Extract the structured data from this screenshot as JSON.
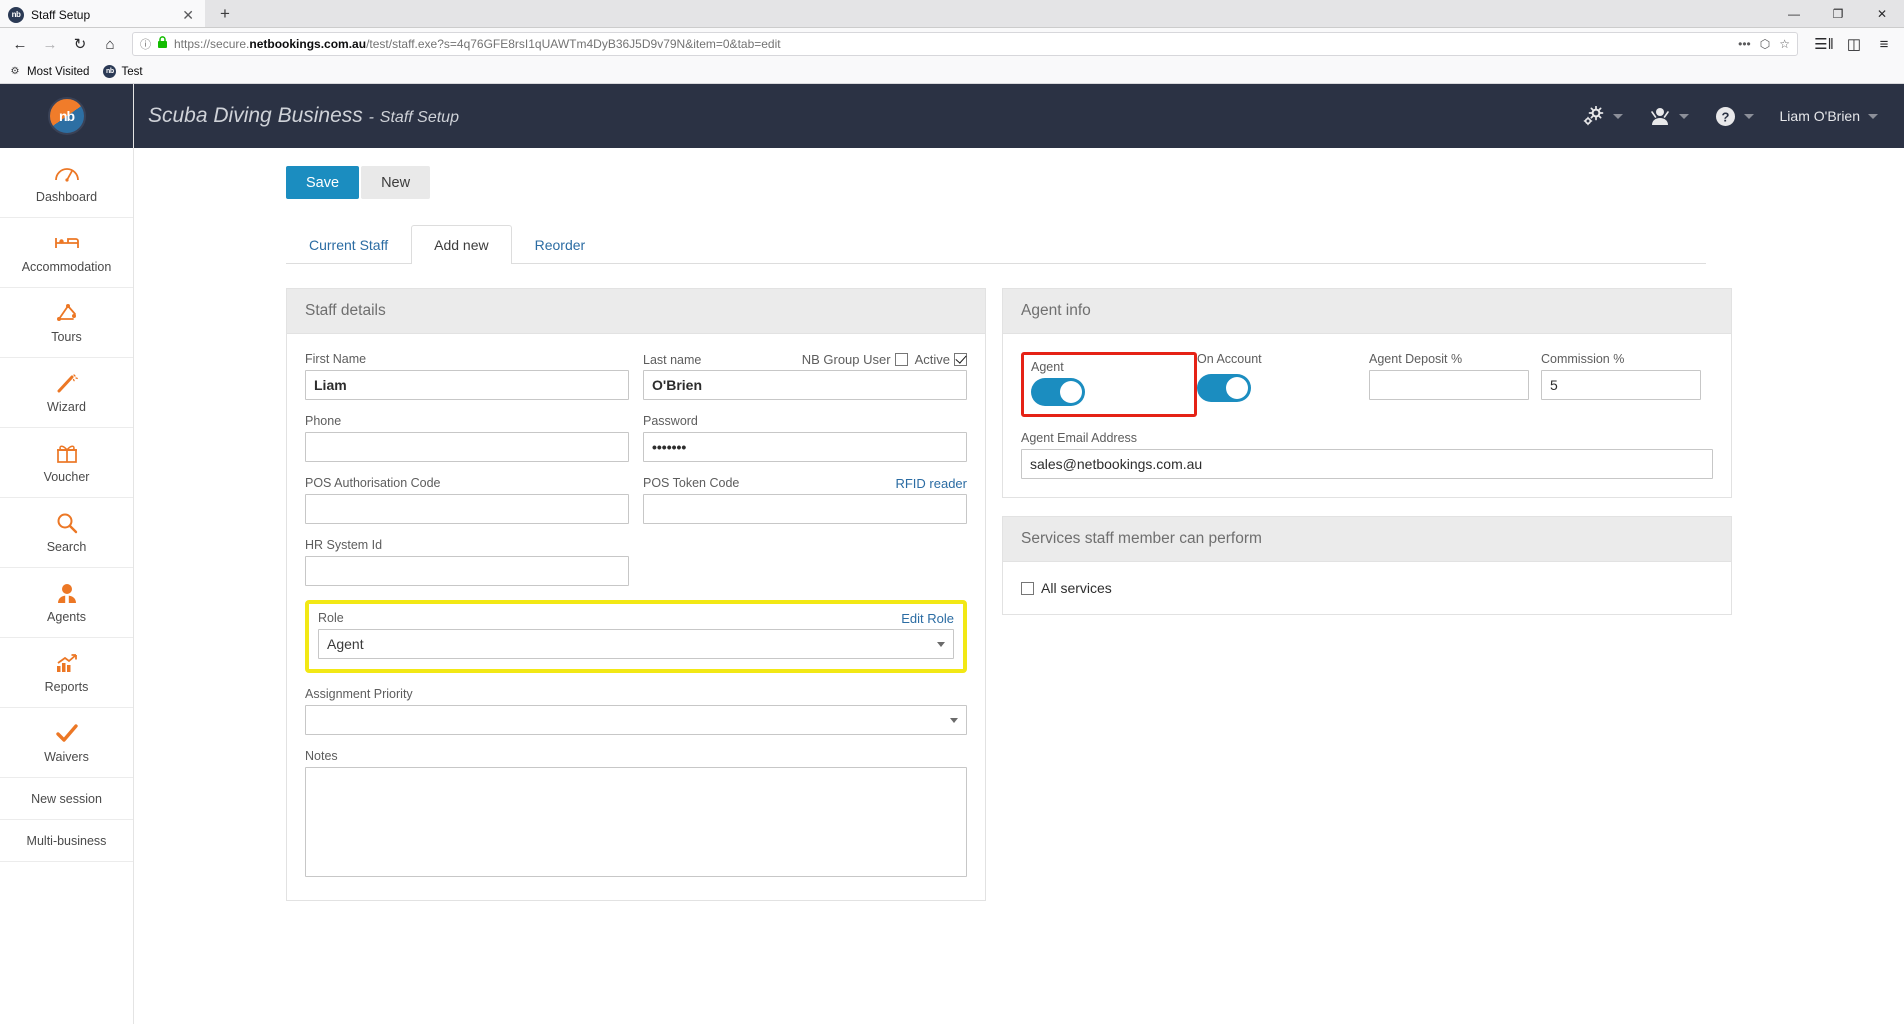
{
  "browser": {
    "tab": {
      "title": "Staff Setup",
      "favicon_text": "nb",
      "close_label": "✕"
    },
    "newtab_label": "+",
    "window_controls": {
      "minimize": "—",
      "maximize": "❐",
      "close": "✕"
    },
    "nav": {
      "back": "←",
      "forward": "→",
      "reload": "↻",
      "home": "⌂",
      "info_icon": "ⓘ",
      "lock_icon": "🔒",
      "url_prefix": "https://secure.",
      "url_domain": "netbookings.com.au",
      "url_suffix": "/test/staff.exe?s=4q76GFE8rsI1qUAWTm4DyB36J5D9v79N&item=0&tab=edit",
      "menu_dots": "•••",
      "pocket": "⬡",
      "bookmark_star": "☆",
      "library": "☰‖",
      "sidebars": "◫",
      "hamburger": "≡"
    },
    "bookmarks": [
      {
        "label": "Most Visited",
        "icon": "gear-icon"
      },
      {
        "label": "Test",
        "icon": "nb-favicon"
      }
    ]
  },
  "header": {
    "logo_text": "nb",
    "business_name": "Scuba Diving Business",
    "separator": "-",
    "page_name": "Staff Setup",
    "user_name": "Liam O'Brien",
    "icons": [
      "gear-icon",
      "user-icon",
      "help-icon"
    ]
  },
  "sidebar": {
    "items": [
      {
        "label": "Dashboard",
        "icon": "dashboard-icon"
      },
      {
        "label": "Accommodation",
        "icon": "bed-icon"
      },
      {
        "label": "Tours",
        "icon": "tours-icon"
      },
      {
        "label": "Wizard",
        "icon": "wand-icon"
      },
      {
        "label": "Voucher",
        "icon": "gift-icon"
      },
      {
        "label": "Search",
        "icon": "search-icon"
      },
      {
        "label": "Agents",
        "icon": "agent-icon"
      },
      {
        "label": "Reports",
        "icon": "chart-icon"
      },
      {
        "label": "Waivers",
        "icon": "check-icon"
      }
    ],
    "plain_items": [
      {
        "label": "New session"
      },
      {
        "label": "Multi-business"
      }
    ]
  },
  "toolbar": {
    "save_label": "Save",
    "new_label": "New"
  },
  "tabs": [
    {
      "label": "Current Staff",
      "active": false
    },
    {
      "label": "Add new",
      "active": true
    },
    {
      "label": "Reorder",
      "active": false
    }
  ],
  "staff_details": {
    "title": "Staff details",
    "first_name": {
      "label": "First Name",
      "value": "Liam"
    },
    "last_name": {
      "label": "Last name",
      "value": "O'Brien"
    },
    "nb_group_user": {
      "label": "NB Group User",
      "checked": false
    },
    "active": {
      "label": "Active",
      "checked": true
    },
    "phone": {
      "label": "Phone",
      "value": ""
    },
    "password": {
      "label": "Password",
      "value": "•••••••"
    },
    "pos_auth_code": {
      "label": "POS Authorisation Code",
      "value": ""
    },
    "pos_token_code": {
      "label": "POS Token Code",
      "value": ""
    },
    "rfid_reader_link": "RFID reader",
    "hr_system_id": {
      "label": "HR System Id",
      "value": ""
    },
    "role": {
      "label": "Role",
      "value": "Agent",
      "edit_link": "Edit Role"
    },
    "assignment_priority": {
      "label": "Assignment Priority",
      "value": ""
    },
    "notes": {
      "label": "Notes",
      "value": ""
    }
  },
  "agent_info": {
    "title": "Agent info",
    "agent": {
      "label": "Agent",
      "on": true
    },
    "on_account": {
      "label": "On Account",
      "on": true
    },
    "agent_deposit_pct": {
      "label": "Agent Deposit %",
      "value": ""
    },
    "commission_pct": {
      "label": "Commission %",
      "value": "5"
    },
    "agent_email": {
      "label": "Agent Email Address",
      "value": "sales@netbookings.com.au"
    }
  },
  "services": {
    "title": "Services staff member can perform",
    "all_services": {
      "label": "All services",
      "checked": false
    }
  },
  "colors": {
    "accent_blue": "#1b8dc0",
    "orange": "#ec7725",
    "dark_navy": "#2b3244",
    "highlight_yellow": "#f2e815",
    "highlight_red": "#e52216"
  }
}
